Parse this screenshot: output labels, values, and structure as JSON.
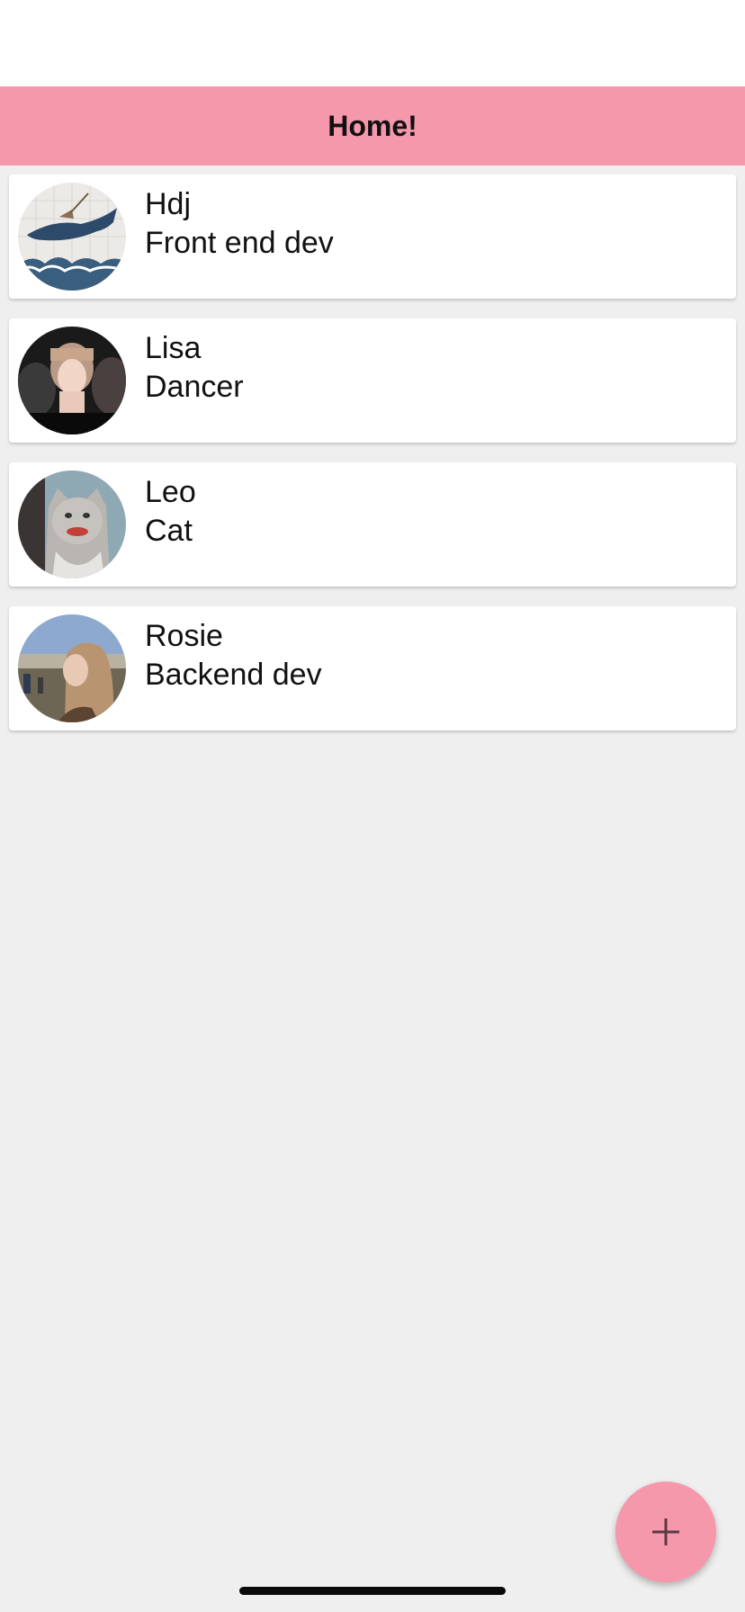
{
  "header": {
    "title": "Home!"
  },
  "contacts": [
    {
      "name": "Hdj",
      "role": "Front end dev",
      "avatar": "whale-avatar"
    },
    {
      "name": "Lisa",
      "role": "Dancer",
      "avatar": "person-avatar"
    },
    {
      "name": "Leo",
      "role": "Cat",
      "avatar": "cat-avatar"
    },
    {
      "name": "Rosie",
      "role": "Backend dev",
      "avatar": "person-avatar"
    }
  ],
  "fab": {
    "icon": "plus-icon"
  },
  "colors": {
    "header": "#f598ab",
    "fab": "#f598ab",
    "background": "#efefef"
  }
}
